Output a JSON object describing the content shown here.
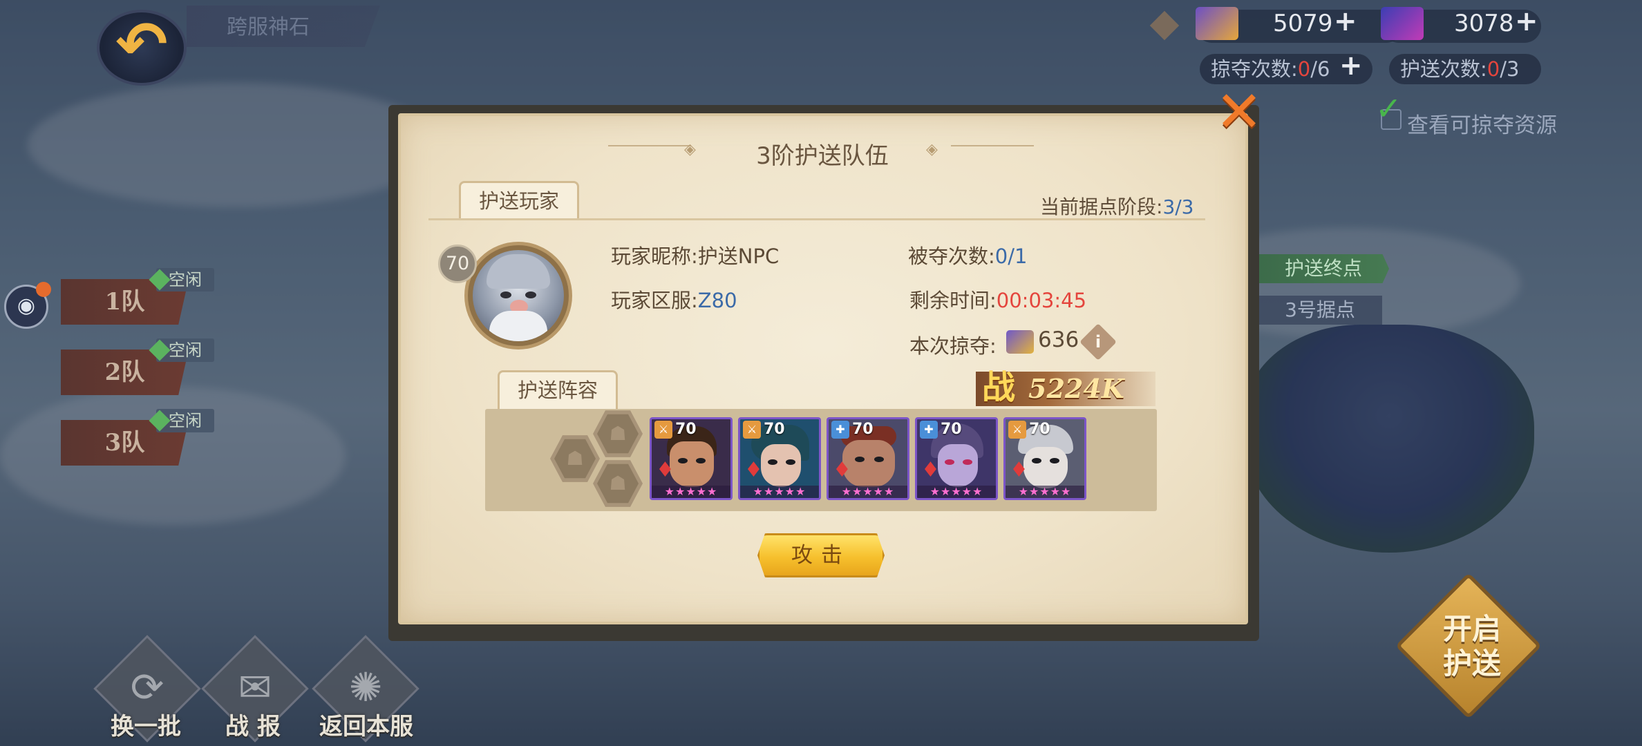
{
  "top_bar": {
    "back_title": "跨服神石",
    "resource_1_value": "5079",
    "resource_2_value": "3078",
    "plunder_count": {
      "label": "掠夺次数:",
      "used": "0",
      "total": "/6"
    },
    "escort_count": {
      "label": "护送次数:",
      "used": "0",
      "total": "/3"
    },
    "view_plunderable_label": "查看可掠夺资源",
    "plus": "+"
  },
  "teams": [
    {
      "label": "1队",
      "status": "空闲"
    },
    {
      "label": "2队",
      "status": "空闲"
    },
    {
      "label": "3队",
      "status": "空闲"
    }
  ],
  "route": {
    "end_label": "护送终点",
    "point_label": "3号据点"
  },
  "bottom_actions": [
    {
      "label": "换一批",
      "icon": "refresh-icon"
    },
    {
      "label": "战 报",
      "icon": "battle-report-icon"
    },
    {
      "label": "返回本服",
      "icon": "return-server-icon"
    }
  ],
  "start_escort_label": "开启\n护送",
  "dialog": {
    "title": "3阶护送队伍",
    "tab_player": "护送玩家",
    "stage_label": "当前据点阶段:",
    "stage_value": "3/3",
    "player": {
      "level": "70",
      "nickname_label": "玩家昵称:",
      "nickname": "护送NPC",
      "server_label": "玩家区服:",
      "server": "Z80",
      "robbed_label": "被夺次数:",
      "robbed_value": "0/1",
      "remaining_label": "剩余时间:",
      "remaining_value": "00:03:45",
      "loot_label": "本次掠夺:",
      "loot_value": "636"
    },
    "tab_lineup": "护送阵容",
    "power_icon": "战",
    "power_value": "5224K",
    "heroes": [
      {
        "level": "70",
        "bg": "#3a2c4a",
        "skin": "#c98f6c",
        "hair": "#3b2518"
      },
      {
        "level": "70",
        "bg": "#1f4f6e",
        "skin": "#e4c2b0",
        "hair": "#1e4a58"
      },
      {
        "level": "70",
        "bg": "#4b4a6a",
        "skin": "#b8826a",
        "hair": "#7a2f24"
      },
      {
        "level": "70",
        "bg": "#3e3568",
        "skin": "#b9a6d8",
        "hair": "#564a7c"
      },
      {
        "level": "70",
        "bg": "#5b5e72",
        "skin": "#e5e0dd",
        "hair": "#c7c9d0"
      }
    ],
    "hero_stars": "★★★★★",
    "attack_label": "攻击"
  },
  "colors": {
    "accent_orange": "#f07a2a",
    "highlight_red": "#e4453d",
    "value_blue": "#3b6aa8",
    "idle_green": "#5bb35f",
    "attack_yellow": "#f6c02d"
  }
}
